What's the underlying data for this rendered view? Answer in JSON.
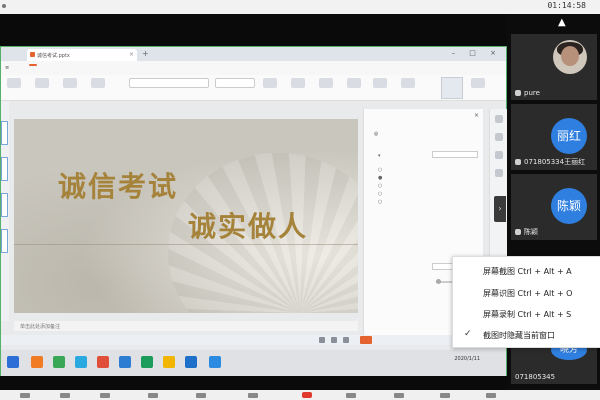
{
  "clock": "01:14:58",
  "document": {
    "tab_title": "诚信考试.pptx",
    "slide_title_1": "诚信考试",
    "slide_title_2": "诚实做人",
    "notes_placeholder": "单击此处添加备注"
  },
  "taskbar": {
    "date": "2020/1/11"
  },
  "context_menu": {
    "items": [
      {
        "label": "屏幕截图 Ctrl + Alt + A",
        "checked": false
      },
      {
        "label": "屏幕识图 Ctrl + Alt + O",
        "checked": false
      },
      {
        "label": "屏幕录制 Ctrl + Alt + S",
        "checked": false
      },
      {
        "label": "截图时隐藏当前窗口",
        "checked": true
      }
    ]
  },
  "participants": [
    {
      "name": "pure",
      "avatar_type": "photo"
    },
    {
      "name": "071805334王丽红",
      "avatar_text": "丽红"
    },
    {
      "name": "陈颖",
      "avatar_text": "陈颖"
    },
    {
      "name": "071805345",
      "avatar_text": "晓芳"
    }
  ],
  "colors": {
    "title_gold": "#a6833b",
    "avatar_blue": "#2f7fe0",
    "wps_orange": "#e5632e",
    "share_border_green": "#55b16a"
  }
}
